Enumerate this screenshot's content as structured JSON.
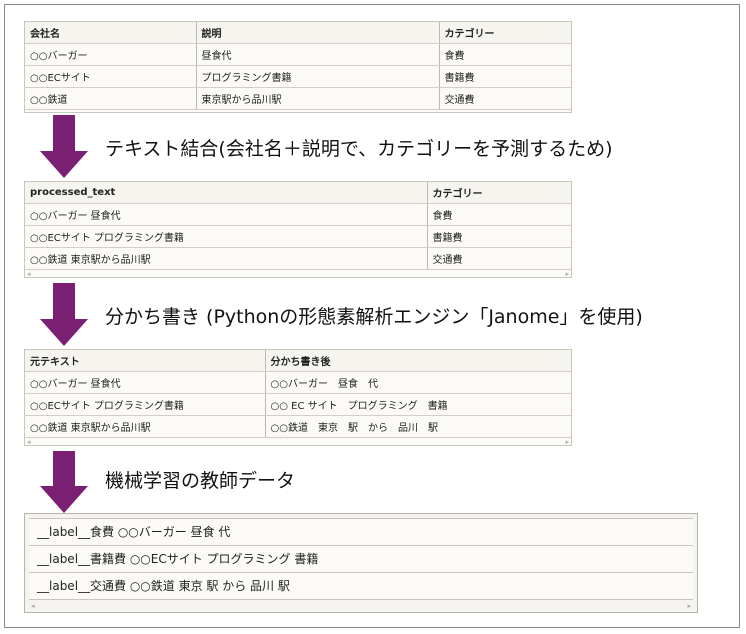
{
  "table1": {
    "headers": [
      "会社名",
      "説明",
      "カテゴリー"
    ],
    "rows": [
      [
        "○○バーガー",
        "昼食代",
        "食費"
      ],
      [
        "○○ECサイト",
        "プログラミング書籍",
        "書籍費"
      ],
      [
        "○○鉄道",
        "東京駅から品川駅",
        "交通費"
      ]
    ]
  },
  "step1": "テキスト結合(会社名＋説明で、カテゴリーを予測するため)",
  "table2": {
    "headers": [
      "processed_text",
      "カテゴリー"
    ],
    "rows": [
      [
        "○○バーガー 昼食代",
        "食費"
      ],
      [
        "○○ECサイト プログラミング書籍",
        "書籍費"
      ],
      [
        "○○鉄道 東京駅から品川駅",
        "交通費"
      ]
    ]
  },
  "step2": "分かち書き (Pythonの形態素解析エンジン「Janome」を使用)",
  "table3": {
    "headers": [
      "元テキスト",
      "分かち書き後"
    ],
    "rows": [
      [
        "○○バーガー 昼食代",
        "○○バーガー　昼食　代"
      ],
      [
        "○○ECサイト プログラミング書籍",
        "○○ EC サイト　プログラミング　書籍"
      ],
      [
        "○○鉄道 東京駅から品川駅",
        "○○鉄道　東京　駅　から　品川　駅"
      ]
    ]
  },
  "step3": "機械学習の教師データ",
  "training_data": [
    "__label__食費 ○○バーガー 昼食 代",
    "__label__書籍費 ○○ECサイト プログラミング 書籍",
    "__label__交通費 ○○鉄道 東京 駅 から 品川 駅"
  ],
  "scroll": {
    "left": "◂",
    "right": "▸"
  },
  "colors": {
    "arrow": "#7b1f73",
    "border": "#8a8a8a"
  }
}
